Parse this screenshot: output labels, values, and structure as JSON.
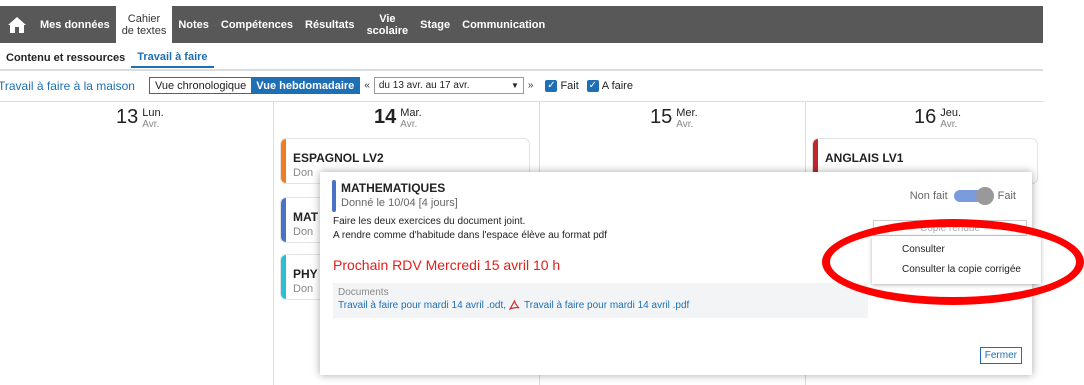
{
  "nav": {
    "home_icon": "home-icon",
    "items": [
      {
        "label": "Mes données"
      },
      {
        "label1": "Cahier",
        "label2": "de textes"
      },
      {
        "label": "Notes"
      },
      {
        "label": "Compétences"
      },
      {
        "label": "Résultats"
      },
      {
        "label1": "Vie",
        "label2": "scolaire"
      },
      {
        "label": "Stage"
      },
      {
        "label": "Communication"
      }
    ]
  },
  "subtabs": [
    "Contenu et ressources",
    "Travail à faire"
  ],
  "toolbar": {
    "title": "Travail à faire à la maison",
    "view_chrono": "Vue chronologique",
    "view_weekly": "Vue hebdomadaire",
    "prev": "«",
    "date_range": "du 13 avr. au 17 avr.",
    "next": "»",
    "fait": "Fait",
    "a_faire": "A faire"
  },
  "days": [
    {
      "num": "13",
      "name": "Lun.",
      "month": "Avr."
    },
    {
      "num": "14",
      "name": "Mar.",
      "month": "Avr."
    },
    {
      "num": "15",
      "name": "Mer.",
      "month": "Avr."
    },
    {
      "num": "16",
      "name": "Jeu.",
      "month": "Avr."
    }
  ],
  "cards": [
    {
      "title": "ESPAGNOL LV2",
      "sub": "Don",
      "color": "#f07b20"
    },
    {
      "title": "MAT",
      "sub": "Don",
      "color": "#4a73c7"
    },
    {
      "title": "PHY",
      "sub": "Don",
      "color": "#2bbfd6"
    },
    {
      "title": "ANGLAIS LV1",
      "sub": "",
      "color": "#c0262c"
    }
  ],
  "popup": {
    "subject": "MATHEMATIQUES",
    "given": "Donné le 10/04 [4 jours]",
    "line1": "Faire les deux exercices du document joint.",
    "line2": "A rendre comme d'habitude dans l'espace élève au format pdf",
    "rdv": "Prochain RDV Mercredi 15 avril 10 h",
    "docs_label": "Documents",
    "doc1": "Travail à faire pour mardi 14 avril .odt,",
    "doc2": "Travail à faire pour mardi 14 avril .pdf",
    "non_fait": "Non fait",
    "fait": "Fait",
    "copie": "Copie rendue",
    "fermer": "Fermer"
  },
  "dropdown": [
    "Consulter",
    "Consulter la copie corrigée"
  ],
  "colors": {
    "accent": "#1f6fb5",
    "annotation": "#ff0000"
  }
}
